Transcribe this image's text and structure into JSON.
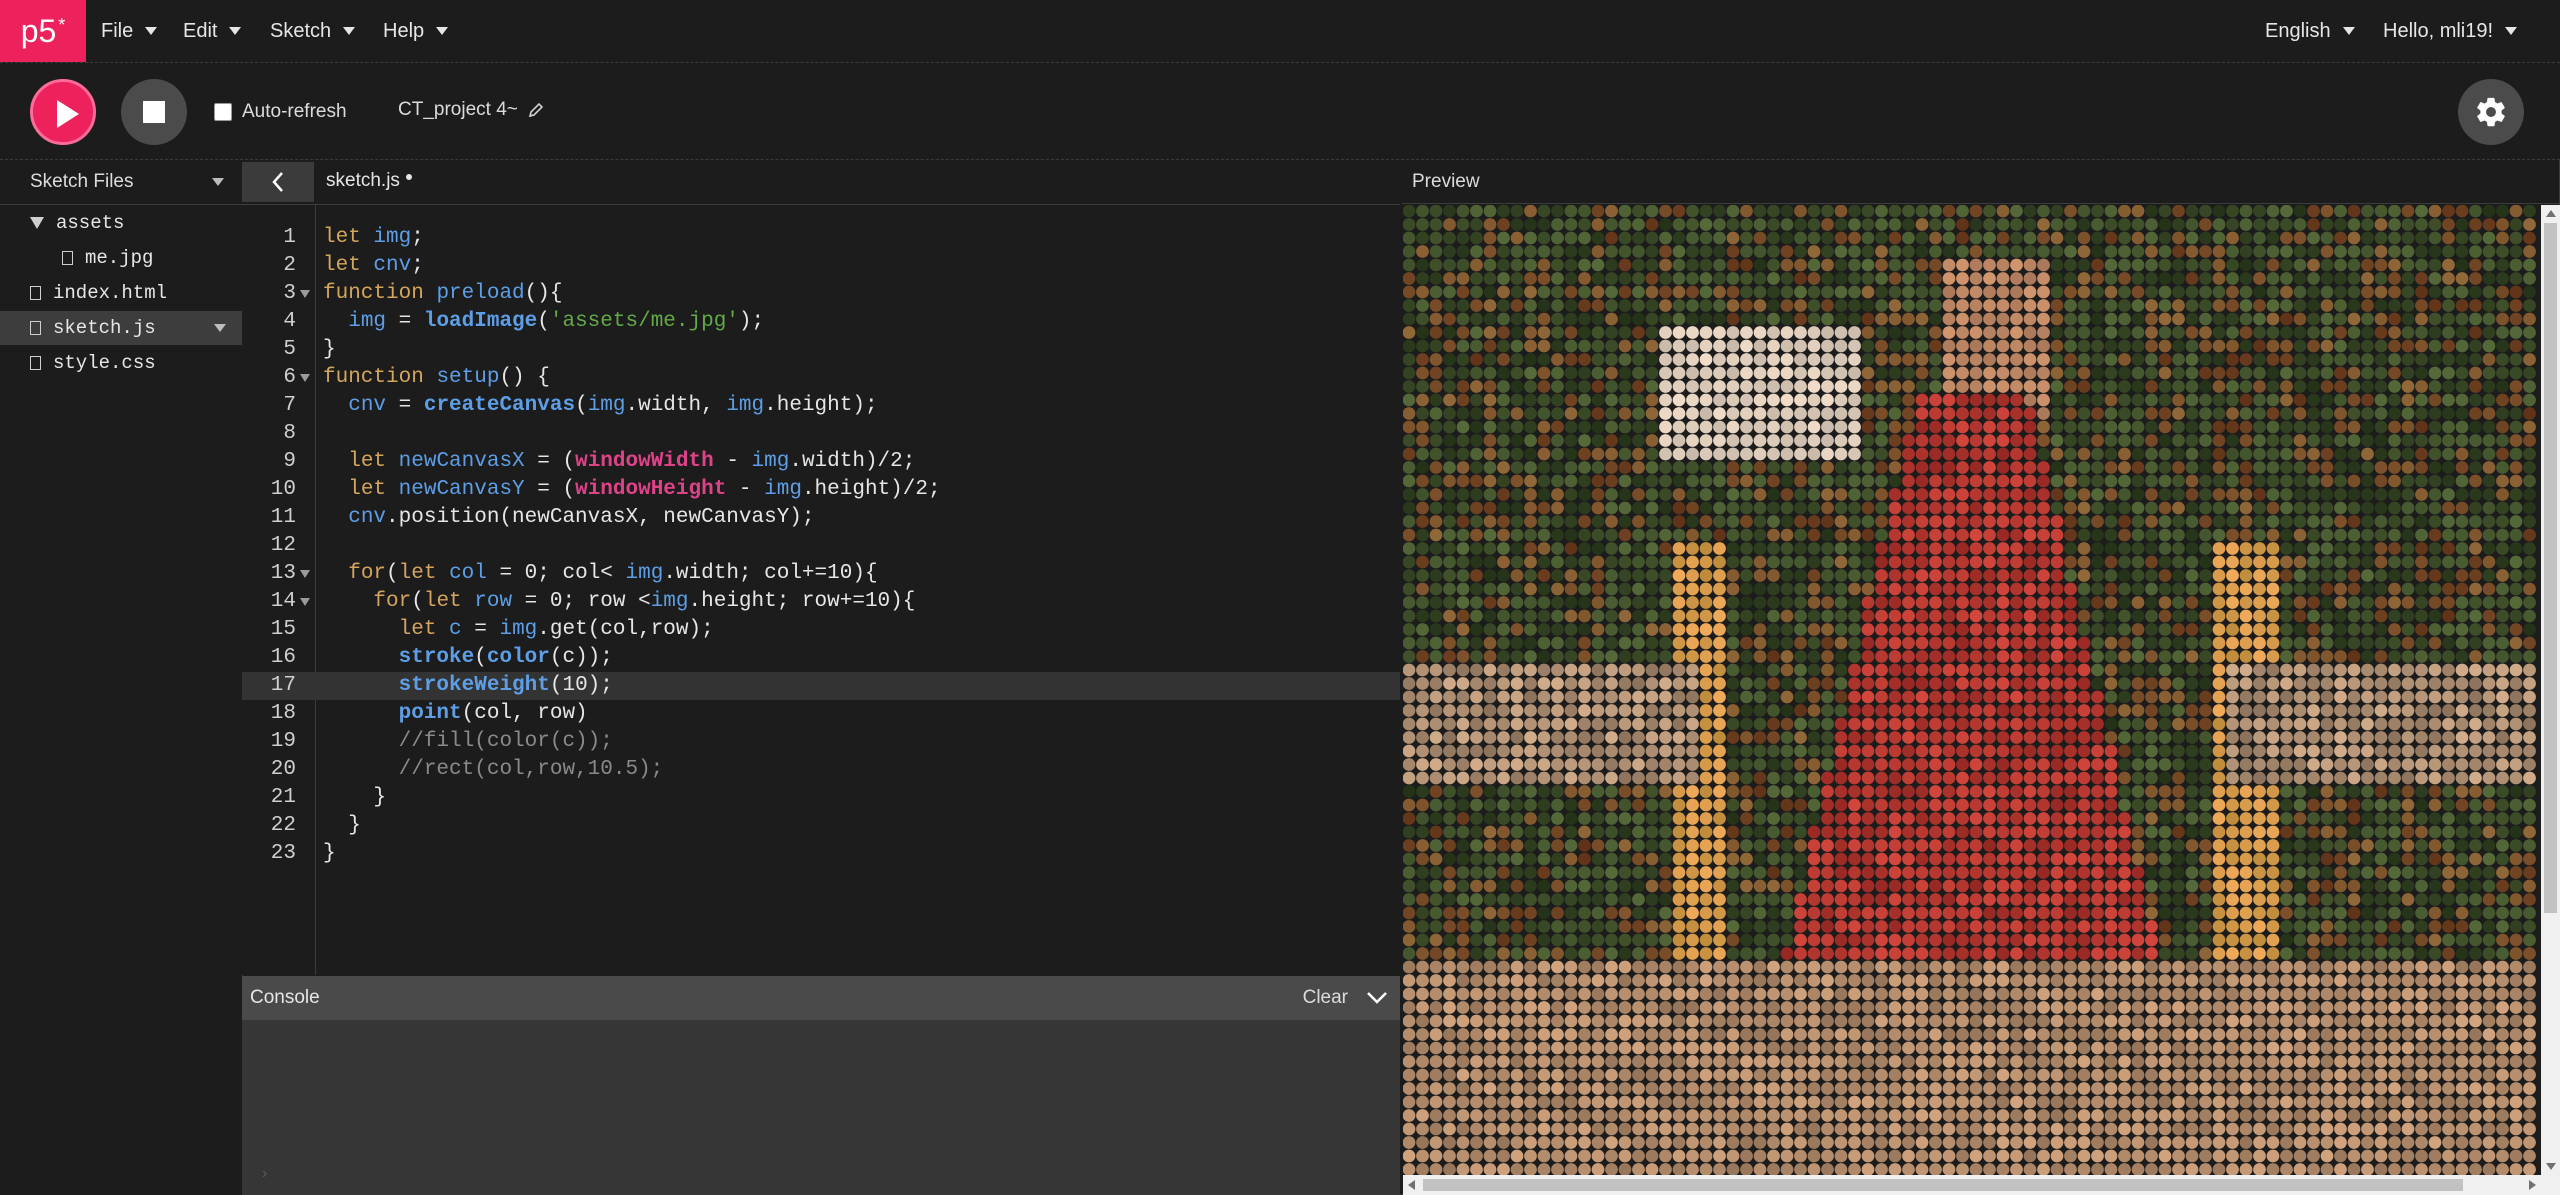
{
  "nav": {
    "logo": "p5",
    "logo_sup": "*",
    "menus": [
      "File",
      "Edit",
      "Sketch",
      "Help"
    ],
    "language": "English",
    "user": "Hello, mli19!"
  },
  "toolbar": {
    "auto_refresh_label": "Auto-refresh",
    "auto_refresh_checked": false,
    "project_name": "CT_project 4~"
  },
  "sidebar": {
    "header": "Sketch Files",
    "items": [
      {
        "label": "assets",
        "type": "folder"
      },
      {
        "label": "me.jpg",
        "type": "file"
      },
      {
        "label": "index.html",
        "type": "file"
      },
      {
        "label": "sketch.js",
        "type": "file",
        "active": true
      },
      {
        "label": "style.css",
        "type": "file"
      }
    ]
  },
  "editor": {
    "tab": "sketch.js",
    "active_line": 17,
    "lines": [
      {
        "n": "1",
        "t": "let img;"
      },
      {
        "n": "2",
        "t": "let cnv;"
      },
      {
        "n": "3",
        "t": "function preload(){"
      },
      {
        "n": "4",
        "t": "  img = loadImage('assets/me.jpg');"
      },
      {
        "n": "5",
        "t": "}"
      },
      {
        "n": "6",
        "t": "function setup() {"
      },
      {
        "n": "7",
        "t": "  cnv = createCanvas(img.width, img.height);"
      },
      {
        "n": "8",
        "t": ""
      },
      {
        "n": "9",
        "t": "  let newCanvasX = (windowWidth - img.width)/2;"
      },
      {
        "n": "10",
        "t": "  let newCanvasY = (windowHeight - img.height)/2;"
      },
      {
        "n": "11",
        "t": "  cnv.position(newCanvasX, newCanvasY);"
      },
      {
        "n": "12",
        "t": ""
      },
      {
        "n": "13",
        "t": "  for(let col = 0; col< img.width; col+=10){"
      },
      {
        "n": "14",
        "t": "    for(let row = 0; row <img.height; row+=10){"
      },
      {
        "n": "15",
        "t": "      let c = img.get(col,row);"
      },
      {
        "n": "16",
        "t": "      stroke(color(c));"
      },
      {
        "n": "17",
        "t": "      strokeWeight(10);"
      },
      {
        "n": "18",
        "t": "      point(col, row)"
      },
      {
        "n": "19",
        "t": "      //fill(color(c));"
      },
      {
        "n": "20",
        "t": "      //rect(col,row,10.5);"
      },
      {
        "n": "21",
        "t": "    }"
      },
      {
        "n": "22",
        "t": "  }"
      },
      {
        "n": "23",
        "t": "}"
      }
    ]
  },
  "console": {
    "title": "Console",
    "clear_label": "Clear"
  },
  "preview": {
    "title": "Preview"
  },
  "colors": {
    "accent": "#ed225d",
    "background": "#1c1c1c",
    "keyword": "#d4a55c",
    "identifier": "#5d9ee6",
    "global": "#e0428a",
    "string": "#62a947",
    "comment": "#8a8a8a"
  }
}
